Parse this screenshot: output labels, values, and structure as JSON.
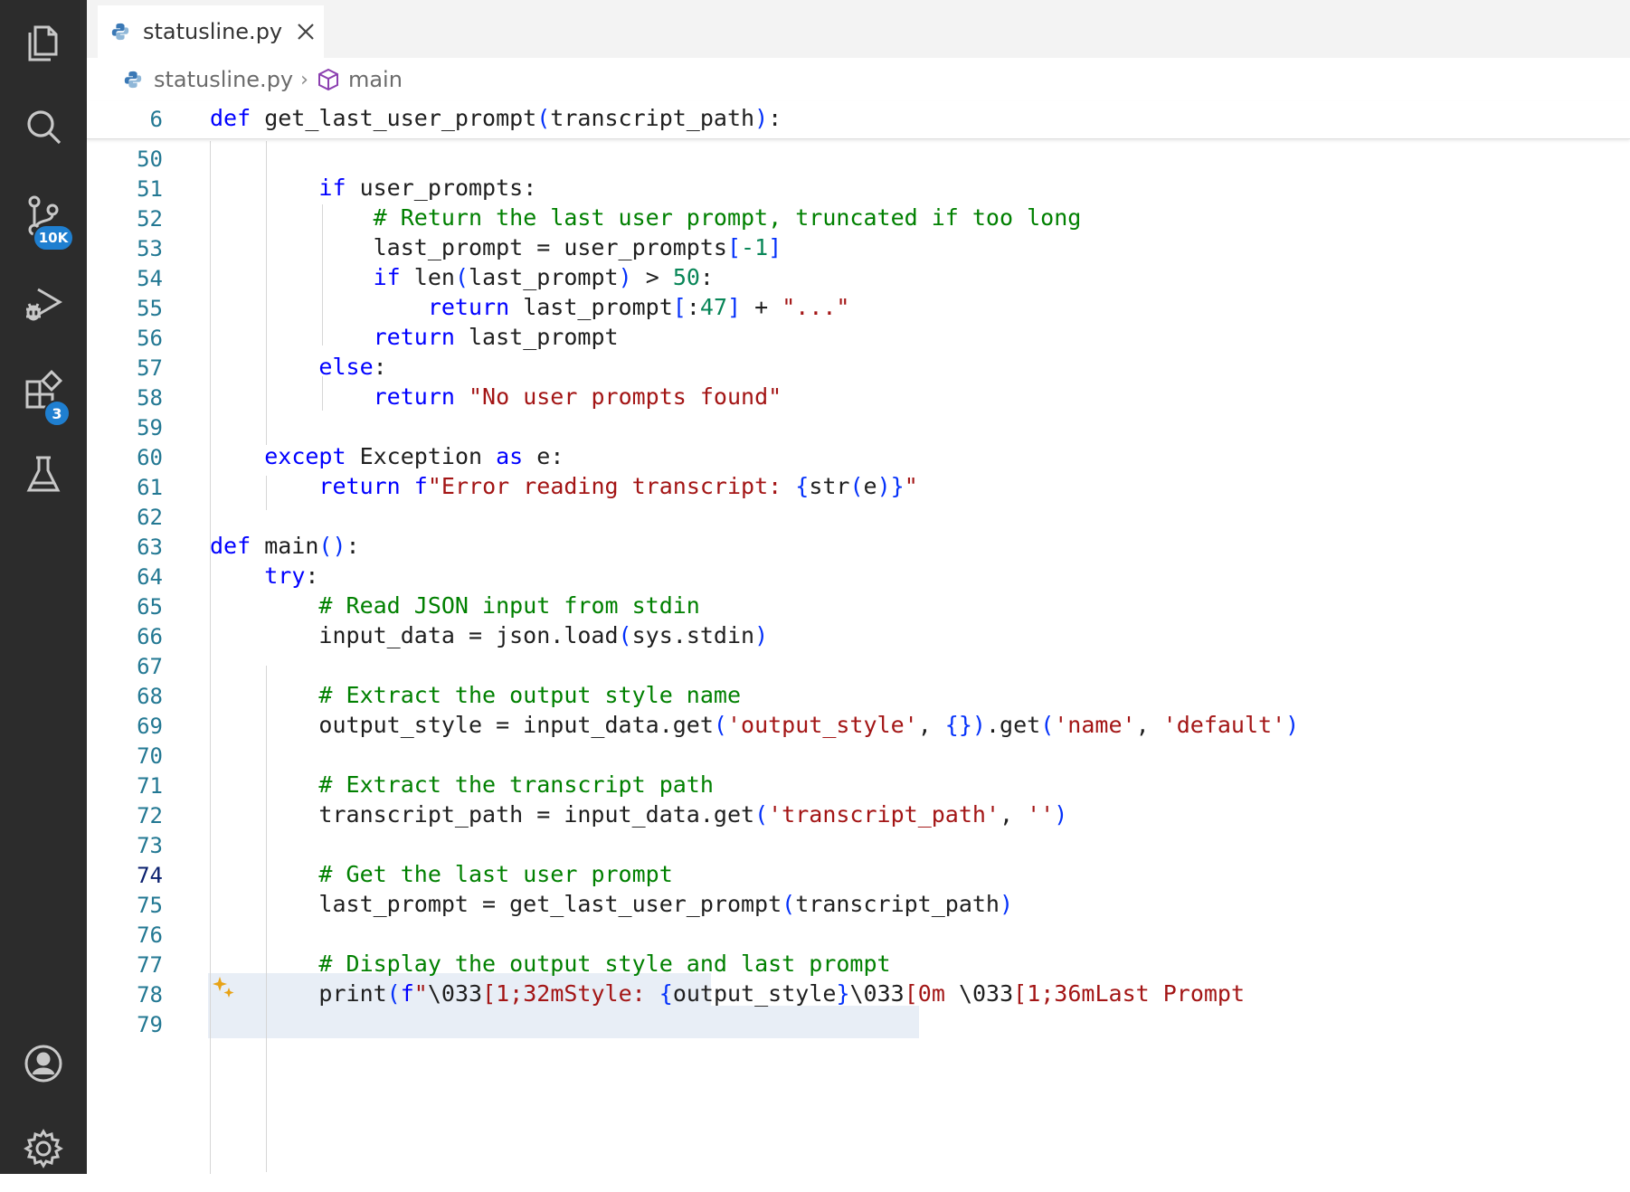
{
  "activity_bar": {
    "items": [
      {
        "name": "explorer-icon",
        "badge": ""
      },
      {
        "name": "search-icon",
        "badge": ""
      },
      {
        "name": "source-control-icon",
        "badge": "10K"
      },
      {
        "name": "run-debug-icon",
        "badge": ""
      },
      {
        "name": "extensions-icon",
        "badge": "3"
      },
      {
        "name": "testing-icon",
        "badge": ""
      }
    ],
    "bottom_items": [
      {
        "name": "accounts-icon"
      },
      {
        "name": "manage-gear-icon"
      }
    ],
    "badges": {
      "source_control": "10K",
      "extensions": "3"
    }
  },
  "tab": {
    "label": "statusline.py",
    "icon": "python-file-icon"
  },
  "breadcrumb": {
    "file": "statusline.py",
    "symbol": "main"
  },
  "sticky": {
    "line_number": "6",
    "tokens": [
      [
        "def",
        "kw"
      ],
      [
        " get_last_user_prompt",
        "tx"
      ],
      [
        "(",
        "pn"
      ],
      [
        "transcript_path",
        "tx"
      ],
      [
        ")",
        "pn"
      ],
      [
        ":",
        "tx"
      ]
    ]
  },
  "lines": [
    {
      "n": "50",
      "tokens": []
    },
    {
      "n": "51",
      "tokens": [
        [
          "        ",
          "tx"
        ],
        [
          "if",
          "kw"
        ],
        [
          " user_prompts:",
          "tx"
        ]
      ]
    },
    {
      "n": "52",
      "tokens": [
        [
          "            ",
          "tx"
        ],
        [
          "# Return the last user prompt, truncated if too long",
          "cm"
        ]
      ]
    },
    {
      "n": "53",
      "tokens": [
        [
          "            last_prompt = user_prompts",
          "tx"
        ],
        [
          "[",
          "pn"
        ],
        [
          "-1",
          "nm"
        ],
        [
          "]",
          "pn"
        ]
      ]
    },
    {
      "n": "54",
      "tokens": [
        [
          "            ",
          "tx"
        ],
        [
          "if",
          "kw"
        ],
        [
          " len",
          "tx"
        ],
        [
          "(",
          "pn"
        ],
        [
          "last_prompt",
          "tx"
        ],
        [
          ")",
          "pn"
        ],
        [
          " > ",
          "tx"
        ],
        [
          "50",
          "nm"
        ],
        [
          ":",
          "tx"
        ]
      ]
    },
    {
      "n": "55",
      "tokens": [
        [
          "                ",
          "tx"
        ],
        [
          "return",
          "kw"
        ],
        [
          " last_prompt",
          "tx"
        ],
        [
          "[",
          "pn"
        ],
        [
          ":",
          "tx"
        ],
        [
          "47",
          "nm"
        ],
        [
          "]",
          "pn"
        ],
        [
          " + ",
          "tx"
        ],
        [
          "\"...\"",
          "st"
        ]
      ]
    },
    {
      "n": "56",
      "tokens": [
        [
          "            ",
          "tx"
        ],
        [
          "return",
          "kw"
        ],
        [
          " last_prompt",
          "tx"
        ]
      ]
    },
    {
      "n": "57",
      "tokens": [
        [
          "        ",
          "tx"
        ],
        [
          "else",
          "kw"
        ],
        [
          ":",
          "tx"
        ]
      ]
    },
    {
      "n": "58",
      "tokens": [
        [
          "            ",
          "tx"
        ],
        [
          "return",
          "kw"
        ],
        [
          " ",
          "tx"
        ],
        [
          "\"No user prompts found\"",
          "st"
        ]
      ]
    },
    {
      "n": "59",
      "tokens": []
    },
    {
      "n": "60",
      "tokens": [
        [
          "    ",
          "tx"
        ],
        [
          "except",
          "kw"
        ],
        [
          " Exception ",
          "tx"
        ],
        [
          "as",
          "kw"
        ],
        [
          " e:",
          "tx"
        ]
      ]
    },
    {
      "n": "61",
      "tokens": [
        [
          "        ",
          "tx"
        ],
        [
          "return",
          "kw"
        ],
        [
          " ",
          "tx"
        ],
        [
          "f",
          "kw"
        ],
        [
          "\"Error reading transcript: ",
          "st"
        ],
        [
          "{",
          "pn"
        ],
        [
          "str",
          "tx"
        ],
        [
          "(",
          "pn"
        ],
        [
          "e",
          "tx"
        ],
        [
          ")",
          "pn"
        ],
        [
          "}",
          "pn"
        ],
        [
          "\"",
          "st"
        ]
      ]
    },
    {
      "n": "62",
      "tokens": []
    },
    {
      "n": "63",
      "tokens": [
        [
          "def",
          "kw"
        ],
        [
          " main",
          "tx"
        ],
        [
          "()",
          "pn"
        ],
        [
          ":",
          "tx"
        ]
      ]
    },
    {
      "n": "64",
      "tokens": [
        [
          "    ",
          "tx"
        ],
        [
          "try",
          "kw"
        ],
        [
          ":",
          "tx"
        ]
      ]
    },
    {
      "n": "65",
      "tokens": [
        [
          "        ",
          "tx"
        ],
        [
          "# Read JSON input from stdin",
          "cm"
        ]
      ]
    },
    {
      "n": "66",
      "tokens": [
        [
          "        input_data = json.load",
          "tx"
        ],
        [
          "(",
          "pn"
        ],
        [
          "sys.stdin",
          "tx"
        ],
        [
          ")",
          "pn"
        ]
      ]
    },
    {
      "n": "67",
      "tokens": []
    },
    {
      "n": "68",
      "tokens": [
        [
          "        ",
          "tx"
        ],
        [
          "# Extract the output style name",
          "cm"
        ]
      ]
    },
    {
      "n": "69",
      "tokens": [
        [
          "        output_style = input_data.get",
          "tx"
        ],
        [
          "(",
          "pn"
        ],
        [
          "'output_style'",
          "st"
        ],
        [
          ", ",
          "tx"
        ],
        [
          "{}",
          "pn"
        ],
        [
          ")",
          "pn"
        ],
        [
          ".get",
          "tx"
        ],
        [
          "(",
          "pn"
        ],
        [
          "'name'",
          "st"
        ],
        [
          ", ",
          "tx"
        ],
        [
          "'default'",
          "st"
        ],
        [
          ")",
          "pn"
        ]
      ]
    },
    {
      "n": "70",
      "tokens": []
    },
    {
      "n": "71",
      "tokens": [
        [
          "        ",
          "tx"
        ],
        [
          "# Extract the transcript path",
          "cm"
        ]
      ]
    },
    {
      "n": "72",
      "tokens": [
        [
          "        transcript_path = input_data.get",
          "tx"
        ],
        [
          "(",
          "pn"
        ],
        [
          "'transcript_path'",
          "st"
        ],
        [
          ", ",
          "tx"
        ],
        [
          "''",
          "st"
        ],
        [
          ")",
          "pn"
        ]
      ]
    },
    {
      "n": "73",
      "tokens": []
    },
    {
      "n": "74",
      "tokens": [
        [
          "        ",
          "tx"
        ],
        [
          "# Get the last user prompt",
          "cm"
        ]
      ]
    },
    {
      "n": "75",
      "tokens": [
        [
          "        last_prompt = get_last_user_prompt",
          "tx"
        ],
        [
          "(",
          "pn"
        ],
        [
          "transcript_path",
          "tx"
        ],
        [
          ")",
          "pn"
        ]
      ]
    },
    {
      "n": "76",
      "tokens": []
    },
    {
      "n": "77",
      "tokens": [
        [
          "        ",
          "tx"
        ],
        [
          "# Display the output style and last prompt",
          "cm"
        ]
      ]
    },
    {
      "n": "78",
      "tokens": [
        [
          "        print",
          "tx"
        ],
        [
          "(",
          "pn"
        ],
        [
          "f",
          "kw"
        ],
        [
          "\"",
          "st"
        ],
        [
          "\\033",
          "tx"
        ],
        [
          "[1;32mStyle: ",
          "st"
        ],
        [
          "{",
          "pn"
        ],
        [
          "output_style",
          "tx"
        ],
        [
          "}",
          "pn"
        ],
        [
          "\\033",
          "tx"
        ],
        [
          "[0m ",
          "st"
        ],
        [
          "\\033",
          "tx"
        ],
        [
          "[1;36mLast Prompt",
          "st"
        ]
      ]
    },
    {
      "n": "79",
      "tokens": []
    }
  ],
  "colors": {
    "activity_bar": "#2c2c2c",
    "badge": "#1f7fd0",
    "keyword": "#0000ff",
    "comment": "#008000",
    "string": "#a31515",
    "number": "#098658",
    "line_number": "#237893"
  }
}
